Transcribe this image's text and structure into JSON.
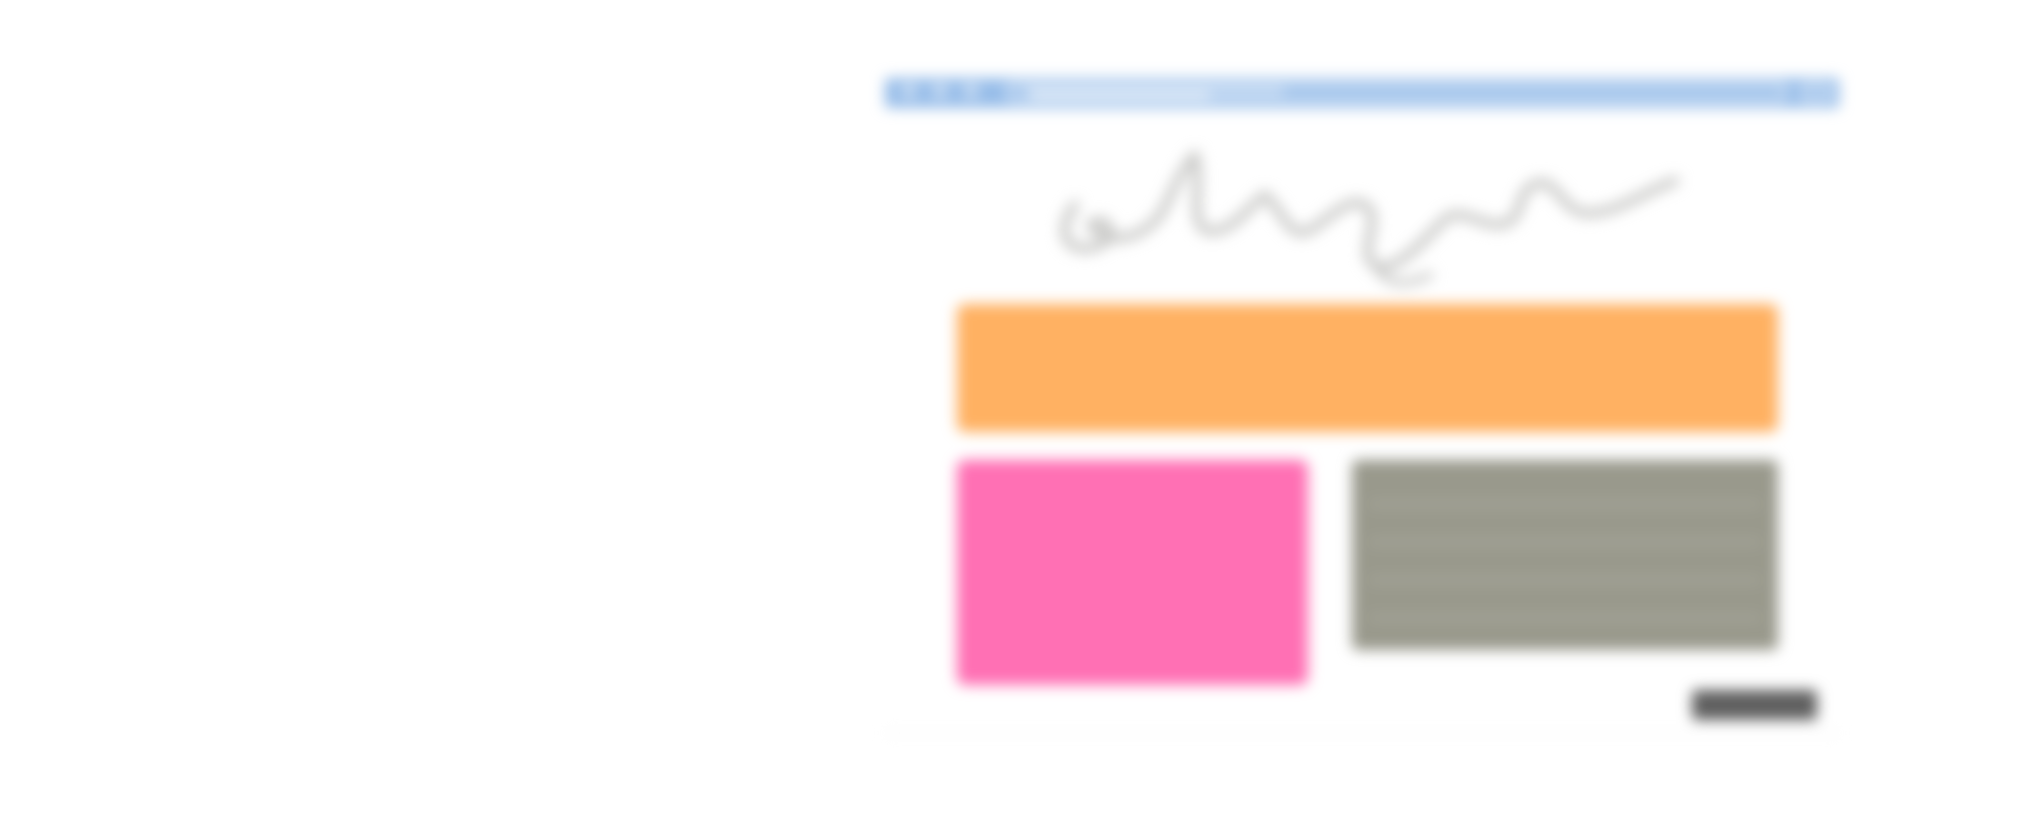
{
  "colors": {
    "browser_bar": "#97bde9",
    "logo_ink": "#c8c8c6",
    "hero_block": "#ffb162",
    "image_block": "#ff70b4",
    "content_block": "#99998c",
    "action_button": "#5f5f5f",
    "background": "#ffffff"
  },
  "browser": {
    "window_controls": [
      "close-dot-icon",
      "minimize-dot-icon",
      "maximize-dot-icon"
    ],
    "address_icon": "address-bar-scribble",
    "tab_icon": "tab-icon"
  },
  "logo": {
    "icon": "handwritten-logo-signature"
  },
  "blocks": {
    "hero": "hero-placeholder",
    "image": "image-placeholder",
    "content": "text-content-placeholder",
    "button": "action-button-placeholder"
  }
}
